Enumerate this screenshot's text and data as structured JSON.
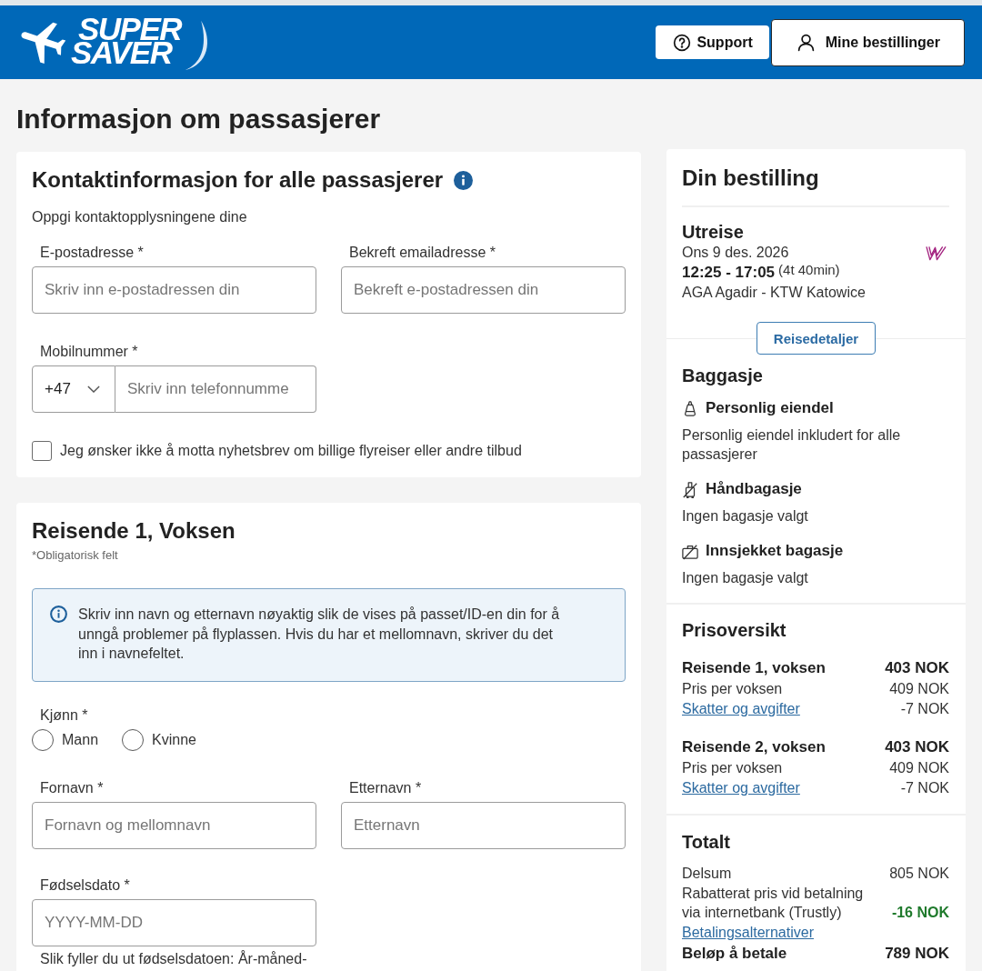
{
  "header": {
    "logo": {
      "line_1": "SUPER",
      "line_2": "SAVER"
    },
    "buttons": [
      {
        "kind": "help",
        "label": "Support"
      },
      {
        "kind": "account",
        "label": "Mine bestillinger"
      }
    ]
  },
  "page_title": "Informasjon om passasjerer",
  "contact": {
    "title": "Kontaktinformasjon for alle passasjerer",
    "subtitle": "Oppgi kontaktopplysningene dine",
    "fields": [
      {
        "label": "E-postadresse *",
        "placeholder": "Skriv inn e-postadressen din"
      },
      {
        "label": "Bekreft emailadresse *",
        "placeholder": "Bekreft e-postadressen din"
      }
    ],
    "phone": {
      "label": "Mobilnummer *",
      "country_code": "+47",
      "placeholder": "Skriv inn telefonnumme"
    },
    "newsletter": {
      "label": "Jeg ønsker ikke å motta nyhetsbrev om billige flyreiser eller andre tilbud",
      "checked": false
    }
  },
  "traveler": {
    "title": "Reisende 1, Voksen",
    "required_note": "*Obligatorisk felt",
    "notice": "Skriv inn navn og etternavn nøyaktig slik de vises på passet/ID-en din for å unngå problemer på flyplassen. Hvis du har et mellomnavn, skriver du det inn i navnefeltet.",
    "gender": {
      "label": "Kjønn *",
      "options": [
        {
          "label": "Mann",
          "selected": false
        },
        {
          "label": "Kvinne",
          "selected": false
        }
      ]
    },
    "name_fields": [
      {
        "label": "Fornavn *",
        "placeholder": "Fornavn og mellomnavn"
      },
      {
        "label": "Etternavn *",
        "placeholder": "Etternavn"
      }
    ],
    "birth_date": {
      "label": "Fødselsdato *",
      "placeholder": "YYYY-MM-DD",
      "hint": "Slik fyller du ut fødselsdatoen: År-måned-"
    }
  },
  "order": {
    "title": "Din bestilling",
    "flight": {
      "direction": "Utreise",
      "date": "Ons 9 des. 2026",
      "times": "12:25 - 17:05",
      "duration": "(4t 40min)",
      "route": "AGA Agadir - KTW Katowice"
    },
    "details_button": "Reisedetaljer",
    "baggage": {
      "title": "Baggasje",
      "items": [
        {
          "kind": "personal",
          "included": true,
          "name": "Personlig eiendel",
          "description": "Personlig eiendel inkludert for alle passasjerer"
        },
        {
          "kind": "cabin",
          "included": false,
          "name": "Håndbagasje",
          "description": "Ingen bagasje valgt"
        },
        {
          "kind": "checked",
          "included": false,
          "name": "Innsjekket bagasje",
          "description": "Ingen bagasje valgt"
        }
      ]
    },
    "prices": {
      "title": "Prisoversikt",
      "travelers": [
        {
          "name": "Reisende 1, voksen",
          "total": "403 NOK",
          "lines": [
            {
              "kind": "plain",
              "label": "Pris per voksen",
              "amount": "409 NOK"
            },
            {
              "kind": "link",
              "label": "Skatter og avgifter",
              "amount": "-7 NOK"
            }
          ]
        },
        {
          "name": "Reisende 2, voksen",
          "total": "403 NOK",
          "lines": [
            {
              "kind": "plain",
              "label": "Pris per voksen",
              "amount": "409 NOK"
            },
            {
              "kind": "link",
              "label": "Skatter og avgifter",
              "amount": "-7 NOK"
            }
          ]
        }
      ]
    },
    "totals": {
      "title": "Totalt",
      "lines": [
        {
          "kind": "plain",
          "label": "Delsum",
          "amount": "805 NOK"
        },
        {
          "kind": "discount",
          "label": "Rabatterat pris vid betalning via internetbank (Trustly)",
          "amount": "-16 NOK"
        },
        {
          "kind": "link",
          "label": "Betalingsalternativer"
        },
        {
          "kind": "total",
          "label": "Beløp å betale",
          "amount": "789 NOK"
        }
      ]
    }
  }
}
